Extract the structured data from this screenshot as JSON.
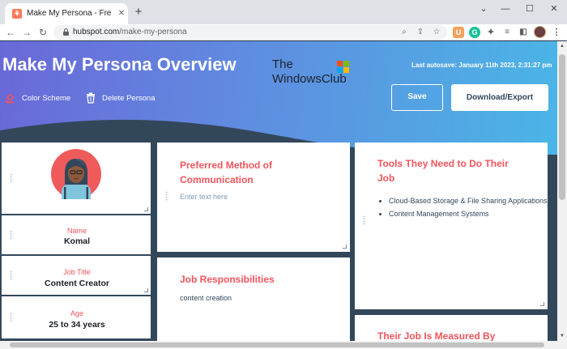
{
  "browser": {
    "tab_title": "Make My Persona - Free Buyer P",
    "tab_favicon": "hubspot-icon",
    "url_host": "hubspot.com",
    "url_path": "/make-my-persona"
  },
  "header": {
    "title": "Make My Persona Overview",
    "watermark_line1": "The",
    "watermark_line2": "WindowsClub",
    "autosave": "Last autosave: January 11th 2023, 2:31:27 pm",
    "color_scheme_label": "Color Scheme",
    "delete_persona_label": "Delete Persona",
    "save_label": "Save",
    "download_label": "Download/Export"
  },
  "profile": {
    "name_label": "Name",
    "name_value": "Komal",
    "job_title_label": "Job Title",
    "job_title_value": "Content Creator",
    "age_label": "Age",
    "age_value": "25 to 34 years"
  },
  "communication": {
    "title": "Preferred Method of Communication",
    "placeholder": "Enter text here"
  },
  "responsibilities": {
    "title": "Job Responsibilities",
    "text": "content creation"
  },
  "tools": {
    "title": "Tools They Need to Do Their Job",
    "items": [
      "Cloud-Based Storage & File Sharing Applications",
      "Content Management Systems"
    ]
  },
  "measured": {
    "title": "Their Job Is Measured By"
  },
  "colors": {
    "accent": "#f2545b",
    "page_bg": "#33475b",
    "header_gradient_start": "#6a68d8",
    "header_gradient_end": "#4ab5e6"
  }
}
